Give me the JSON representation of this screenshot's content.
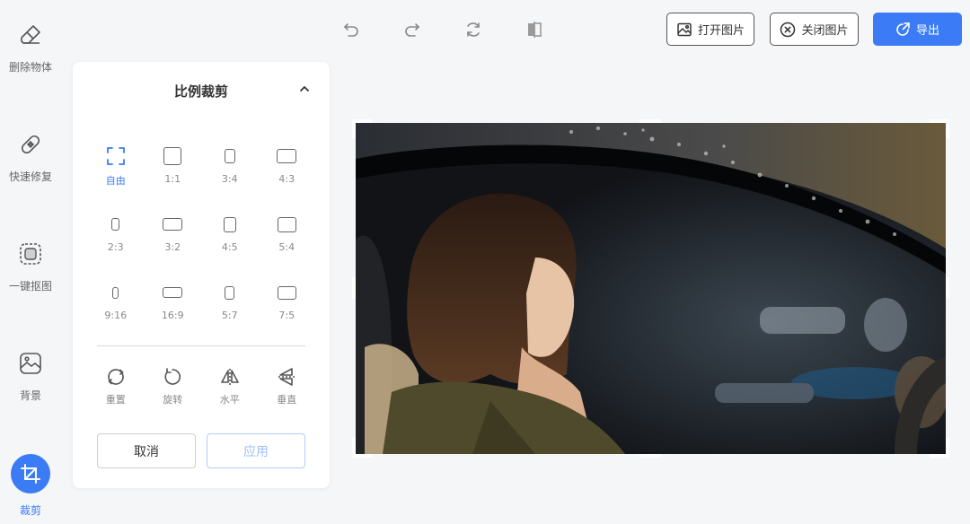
{
  "sidebar": {
    "items": [
      {
        "label": "删除物体",
        "icon": "eraser-icon"
      },
      {
        "label": "快速修复",
        "icon": "bandage-icon"
      },
      {
        "label": "一键抠图",
        "icon": "cutout-icon"
      },
      {
        "label": "背景",
        "icon": "image-icon"
      },
      {
        "label": "裁剪",
        "icon": "crop-icon",
        "active": true
      }
    ]
  },
  "toolbar": {
    "undo_icon": "undo-icon",
    "redo_icon": "redo-icon",
    "reset_icon": "refresh-icon",
    "compare_icon": "compare-icon",
    "open_label": "打开图片",
    "close_label": "关闭图片",
    "export_label": "导出"
  },
  "crop_panel": {
    "title": "比例裁剪",
    "ratios": [
      {
        "label": "自由",
        "active": true
      },
      {
        "label": "1:1"
      },
      {
        "label": "3:4"
      },
      {
        "label": "4:3"
      },
      {
        "label": "2:3"
      },
      {
        "label": "3:2"
      },
      {
        "label": "4:5"
      },
      {
        "label": "5:4"
      },
      {
        "label": "9:16"
      },
      {
        "label": "16:9"
      },
      {
        "label": "5:7"
      },
      {
        "label": "7:5"
      }
    ],
    "tools": [
      {
        "label": "重置",
        "icon": "reset-icon"
      },
      {
        "label": "旋转",
        "icon": "rotate-icon"
      },
      {
        "label": "水平",
        "icon": "flip-horizontal-icon"
      },
      {
        "label": "垂直",
        "icon": "flip-vertical-icon"
      }
    ],
    "cancel_label": "取消",
    "apply_label": "应用"
  },
  "colors": {
    "accent": "#3b7cf6",
    "background": "#f5f6f8"
  }
}
